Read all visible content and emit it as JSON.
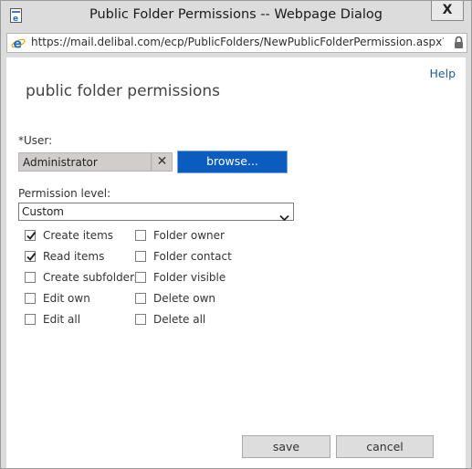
{
  "window": {
    "title": "Public Folder Permissions -- Webpage Dialog",
    "close_glyph": "X",
    "url": "https://mail.delibal.com/ecp/PublicFolders/NewPublicFolderPermission.aspx?mode=new"
  },
  "content": {
    "help_label": "Help",
    "heading": "public folder permissions",
    "user_label": "*User:",
    "user_value": "Administrator",
    "clear_glyph": "✕",
    "browse_label": "browse...",
    "permission_level_label": "Permission level:",
    "permission_level_value": "Custom"
  },
  "checkboxes": [
    {
      "label": "Create items",
      "checked": true
    },
    {
      "label": "Read items",
      "checked": true
    },
    {
      "label": "Create subfolders",
      "checked": false
    },
    {
      "label": "Edit own",
      "checked": false
    },
    {
      "label": "Edit all",
      "checked": false
    },
    {
      "label": "Folder owner",
      "checked": false
    },
    {
      "label": "Folder contact",
      "checked": false
    },
    {
      "label": "Folder visible",
      "checked": false
    },
    {
      "label": "Delete own",
      "checked": false
    },
    {
      "label": "Delete all",
      "checked": false
    }
  ],
  "buttons": {
    "save_label": "save",
    "cancel_label": "cancel"
  },
  "colors": {
    "browse_button": "#0a5cbf",
    "help_link": "#1e5b9b",
    "user_field_bg": "#d2cdcd"
  },
  "icons": {
    "title": "dialog-page-icon",
    "address": "internet-explorer-icon",
    "lock": "lock-icon",
    "select": "chevron-down-icon",
    "check": "checkmark-icon"
  }
}
